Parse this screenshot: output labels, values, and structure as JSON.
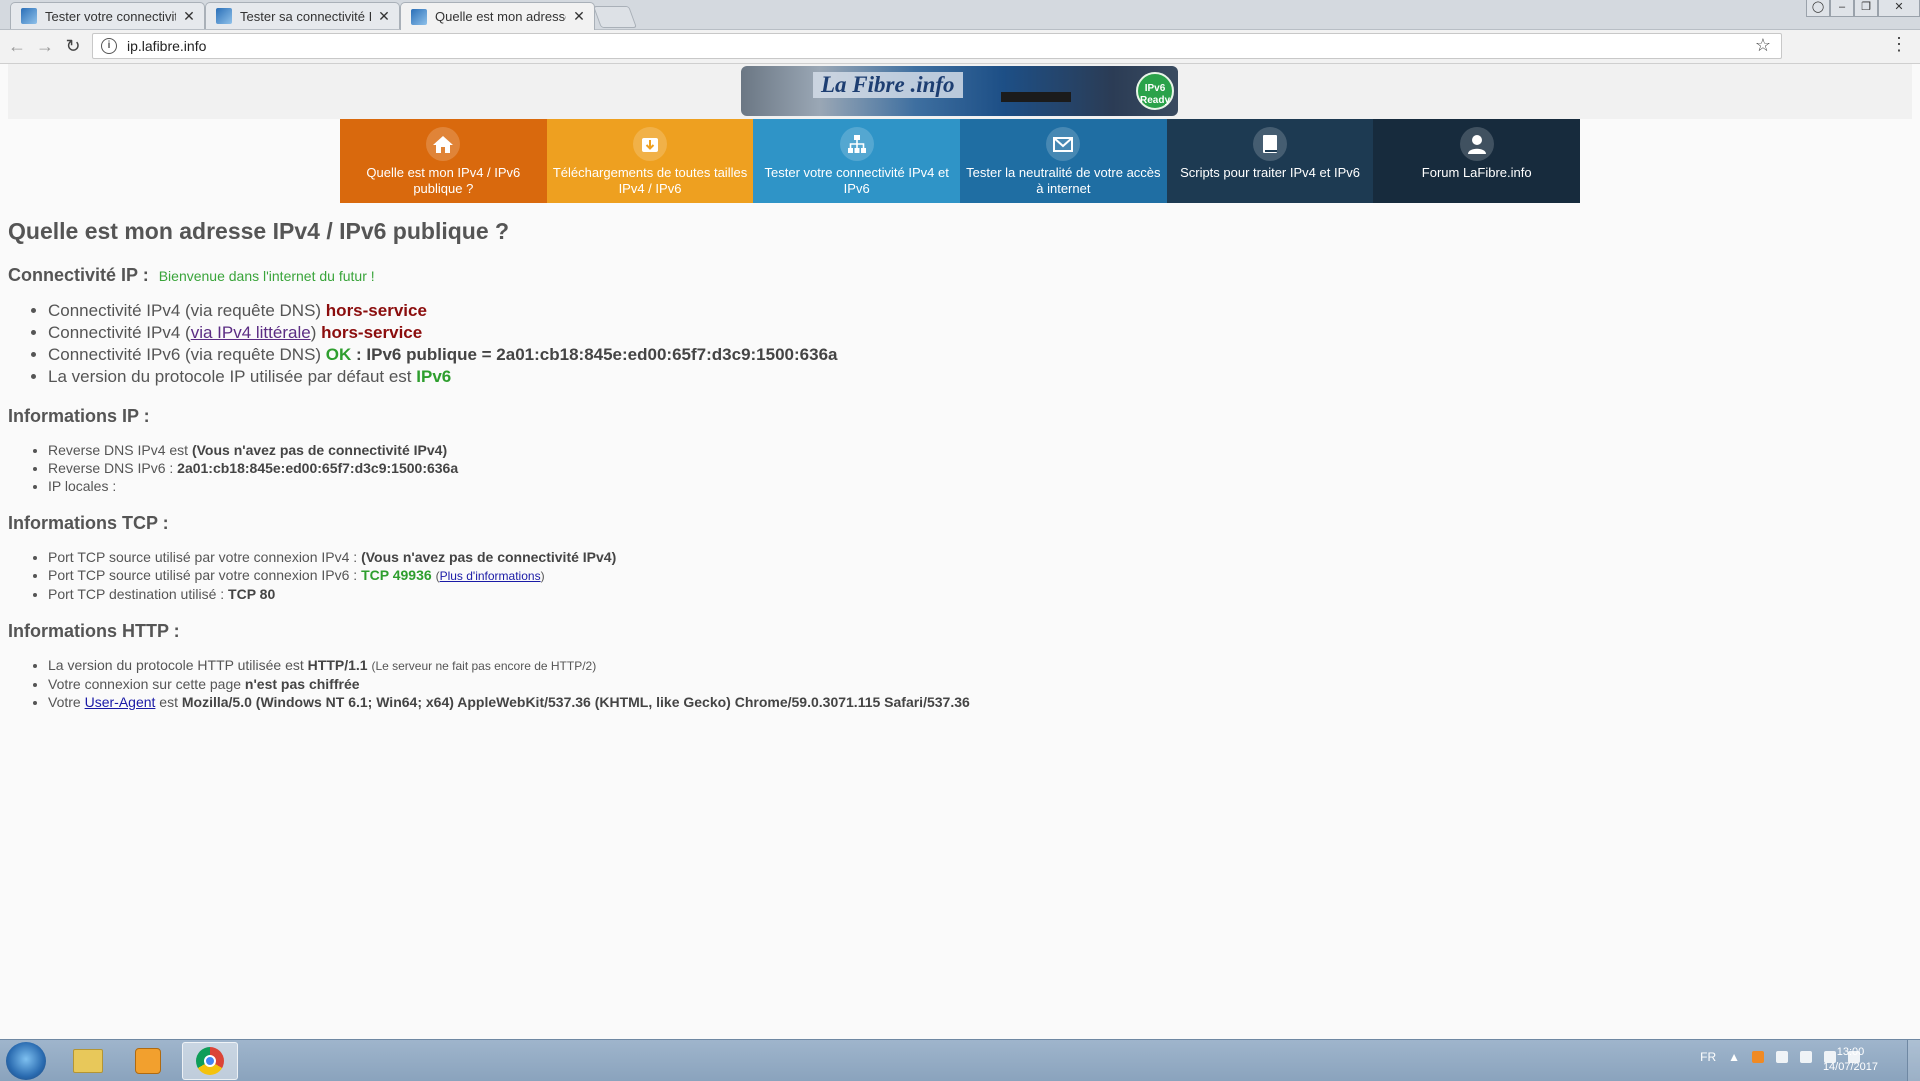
{
  "browser": {
    "tabs": [
      {
        "title": "Tester votre connectivité",
        "close": "✕"
      },
      {
        "title": "Tester sa connectivité IPv",
        "close": "✕"
      },
      {
        "title": "Quelle est mon adresse I",
        "close": "✕"
      }
    ],
    "url": "ip.lafibre.info"
  },
  "logo": {
    "text": "La Fibre .info",
    "badge": "IPv6 Ready"
  },
  "nav": [
    {
      "label": "Quelle est mon IPv4 / IPv6 publique ?",
      "icon": "home-icon",
      "color": "#d9690d"
    },
    {
      "label": "Téléchargements de toutes tailles IPv4 / IPv6",
      "icon": "download-icon",
      "color": "#eea020"
    },
    {
      "label": "Tester votre connectivité IPv4 et IPv6",
      "icon": "network-icon",
      "color": "#2f94c7"
    },
    {
      "label": "Tester la neutralité de votre accès à internet",
      "icon": "envelope-icon",
      "color": "#1f6ea3"
    },
    {
      "label": "Scripts pour traiter IPv4 et IPv6",
      "icon": "book-icon",
      "color": "#1d3a52"
    },
    {
      "label": "Forum LaFibre.info",
      "icon": "user-icon",
      "color": "#172b3d"
    }
  ],
  "page": {
    "title": "Quelle est mon adresse IPv4 / IPv6 publique ?",
    "connectivity": {
      "heading": "Connectivité IP :",
      "welcome": "Bienvenue dans l'internet du futur !",
      "items": [
        {
          "prefix": "Connectivité IPv4 (via requête DNS)",
          "status": "hors-service"
        },
        {
          "prefix": "Connectivité IPv4 (",
          "link": "via IPv4 littérale",
          "suffix": ")",
          "status": "hors-service"
        },
        {
          "prefix": "Connectivité IPv6 (via requête DNS)",
          "status": "OK",
          "detail": ": IPv6 publique = 2a01:cb18:845e:ed00:65f7:d3c9:1500:636a"
        },
        {
          "prefix": "La version du protocole IP utilisée par défaut est",
          "status": "IPv6"
        }
      ]
    },
    "ipinfo": {
      "heading": "Informations IP :",
      "items": [
        {
          "label": "Reverse DNS IPv4 est",
          "value": "(Vous n'avez pas de connectivité IPv4)"
        },
        {
          "label": "Reverse DNS IPv6 :",
          "value": "2a01:cb18:845e:ed00:65f7:d3c9:1500:636a"
        },
        {
          "label": "IP locales :",
          "value": ""
        }
      ]
    },
    "tcp": {
      "heading": "Informations TCP :",
      "items": [
        {
          "label": "Port TCP source utilisé par votre connexion IPv4 :",
          "value": "(Vous n'avez pas de connectivité IPv4)"
        },
        {
          "label": "Port TCP source utilisé par votre connexion IPv6 :",
          "value": "TCP 49936",
          "link": "Plus d'informations"
        },
        {
          "label": "Port TCP destination utilisé :",
          "value": "TCP 80"
        }
      ]
    },
    "http": {
      "heading": "Informations HTTP :",
      "items": [
        {
          "label": "La version du protocole HTTP utilisée est",
          "value": "HTTP/1.1",
          "note": "(Le serveur ne fait pas encore de HTTP/2)"
        },
        {
          "label": "Votre connexion sur cette page",
          "value": "n'est pas chiffrée"
        },
        {
          "label": "Votre",
          "link": "User-Agent",
          "mid": "est",
          "value": "Mozilla/5.0 (Windows NT 6.1; Win64; x64) AppleWebKit/537.36 (KHTML, like Gecko) Chrome/59.0.3071.115 Safari/537.36"
        }
      ]
    }
  },
  "taskbar": {
    "lang": "FR",
    "time": "13:00",
    "date": "14/07/2017"
  }
}
